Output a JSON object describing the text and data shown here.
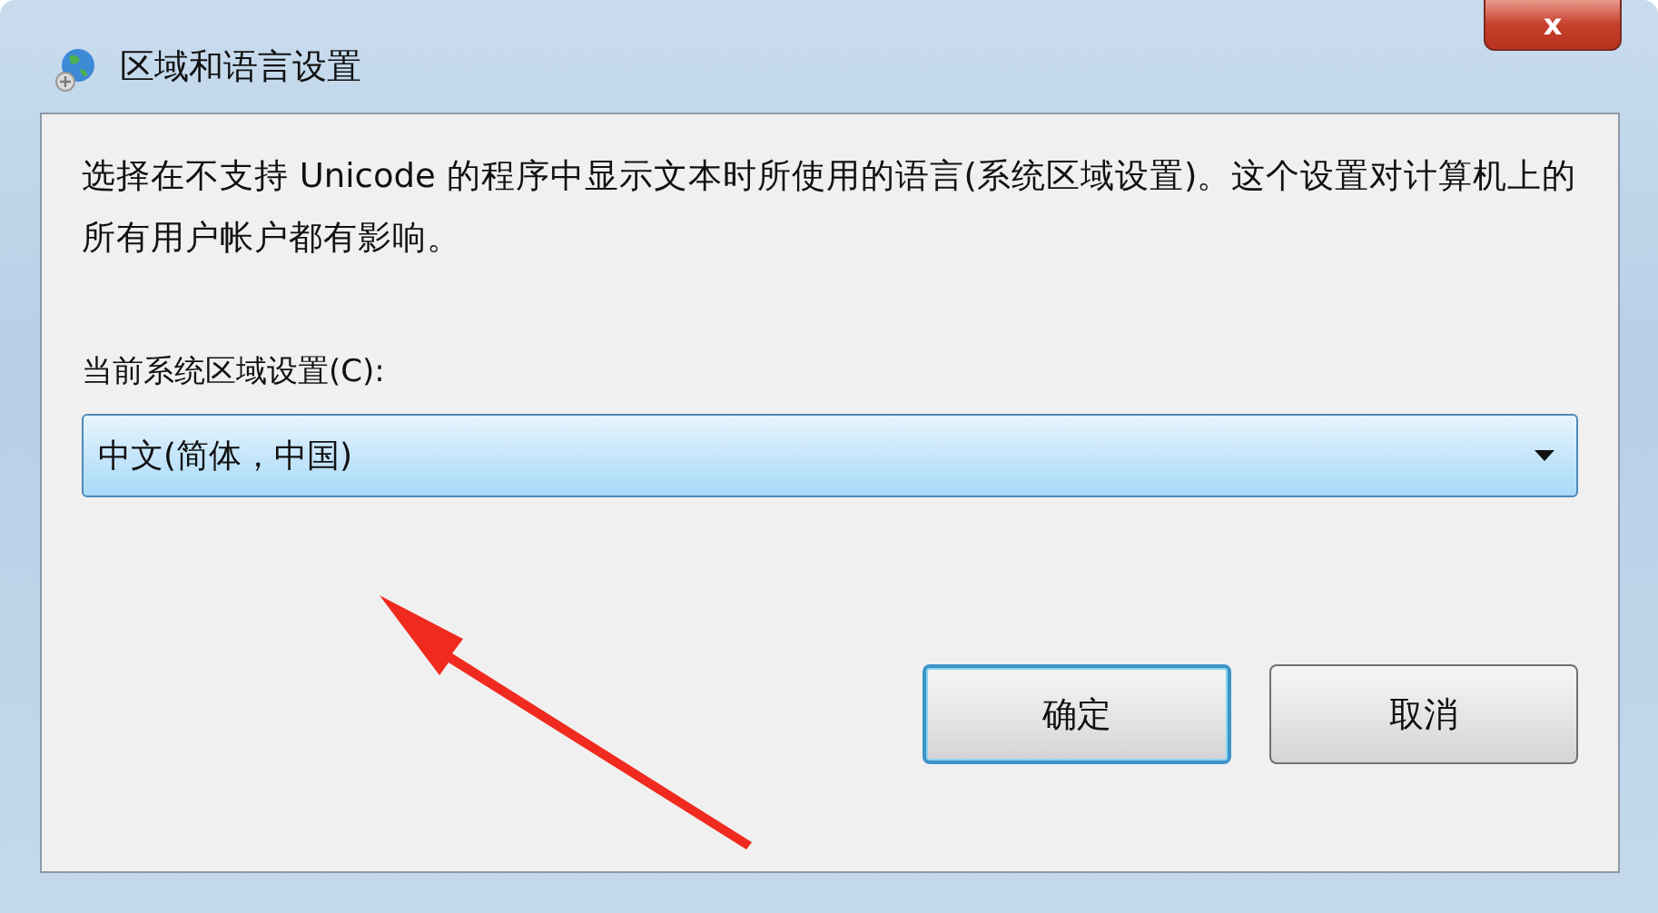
{
  "window": {
    "title": "区域和语言设置",
    "close": "x"
  },
  "description": "选择在不支持 Unicode 的程序中显示文本时所使用的语言(系统区域设置)。这个设置对计算机上的所有用户帐户都有影响。",
  "locale_label": "当前系统区域设置(C):",
  "locale_dropdown": {
    "value": "中文(简体，中国)",
    "focused": true
  },
  "buttons": [
    {
      "label": "确定",
      "default": true
    },
    {
      "label": "取消",
      "default": false
    }
  ]
}
